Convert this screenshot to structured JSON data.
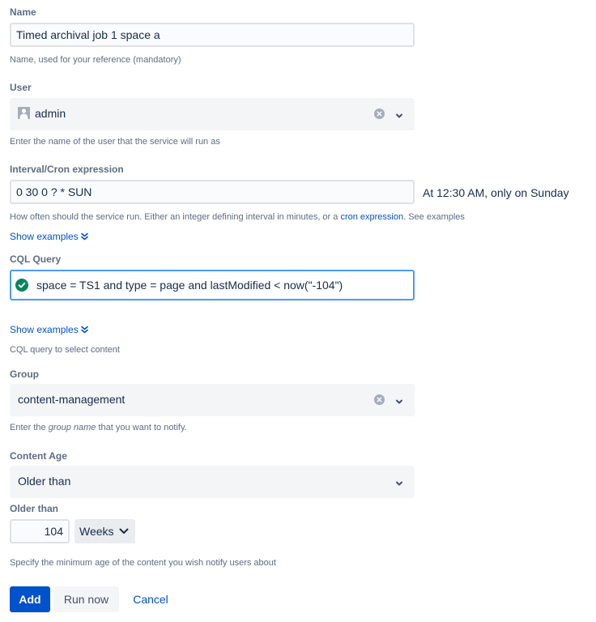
{
  "name_field": {
    "label": "Name",
    "value": "Timed archival job 1 space a",
    "help": "Name, used for your reference (mandatory)"
  },
  "user_field": {
    "label": "User",
    "value": "admin",
    "avatar_icon": "user-avatar-icon",
    "clear_icon": "clear-icon",
    "dropdown_icon": "chevron-down-icon",
    "help": "Enter the name of the user that the service will run as"
  },
  "cron_field": {
    "label": "Interval/Cron expression",
    "value": "0 30 0 ? * SUN",
    "description": "At 12:30 AM, only on Sunday",
    "help_before": "How often should the service run. Either an integer defining interval in minutes, or a ",
    "help_link": "cron expression",
    "help_after": ". See examples",
    "show_examples": "Show examples"
  },
  "cql_field": {
    "label": "CQL Query",
    "value": "space = TS1 and type = page and lastModified < now(\"-104\")",
    "status_icon": "check-circle-icon",
    "show_examples": "Show examples",
    "help": "CQL query to select content"
  },
  "group_field": {
    "label": "Group",
    "value": "content-management",
    "help_before": "Enter the ",
    "help_emphasis": "group name",
    "help_after": " that you want to notify."
  },
  "content_age_field": {
    "label": "Content Age",
    "value": "Older than"
  },
  "older_than_field": {
    "label": "Older than",
    "amount": "104",
    "unit": "Weeks",
    "help": "Specify the minimum age of the content you wish notify users about"
  },
  "actions": {
    "add": "Add",
    "run_now": "Run now",
    "cancel": "Cancel"
  },
  "colors": {
    "primary": "#0052cc",
    "success": "#00875a",
    "focus_border": "#4c9aff",
    "label": "#5e6c84",
    "text": "#172b4d"
  }
}
